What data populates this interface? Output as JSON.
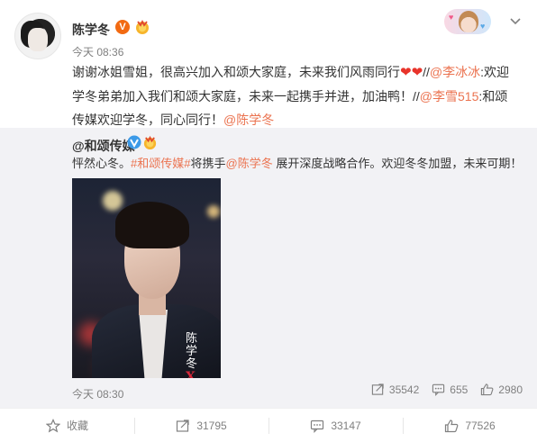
{
  "post": {
    "author": "陈学冬",
    "verified_mark": "V",
    "time": "今天 08:36",
    "text_parts": [
      {
        "t": "text",
        "v": "谢谢冰姐雪姐，很高兴加入和颂大家庭，未来我们风雨同行"
      },
      {
        "t": "heart",
        "v": "❤❤"
      },
      {
        "t": "text",
        "v": "//"
      },
      {
        "t": "link",
        "v": "@李冰冰"
      },
      {
        "t": "text",
        "v": ":欢迎学冬弟弟加入我们和颂大家庭，未来一起携手并进，加油鸭！//"
      },
      {
        "t": "link",
        "v": "@李雪515"
      },
      {
        "t": "text",
        "v": ":和颂传媒欢迎学冬，同心同行！"
      },
      {
        "t": "link",
        "v": "@陈学冬"
      }
    ]
  },
  "repost": {
    "author": "@和颂传媒",
    "text_parts": [
      {
        "t": "text",
        "v": "怦然心冬。"
      },
      {
        "t": "link",
        "v": "#和颂传媒#"
      },
      {
        "t": "text",
        "v": "将携手"
      },
      {
        "t": "link",
        "v": "@陈学冬"
      },
      {
        "t": "text",
        "v": " 展开深度战略合作。欢迎冬冬加盟，未来可期！"
      }
    ],
    "photo_signature": {
      "line1": "陈",
      "line2": "学",
      "line3": "冬",
      "mark": "X"
    },
    "time": "今天 08:30",
    "stats": {
      "reposts": "35542",
      "comments": "655",
      "likes": "2980"
    }
  },
  "actions": {
    "favorite": "收藏",
    "repost": "31795",
    "comment": "33147",
    "like": "77526"
  },
  "colors": {
    "link": "#eb7350",
    "verified": "#f26a12",
    "muted": "#808080",
    "repost_bg": "#f2f2f5"
  }
}
